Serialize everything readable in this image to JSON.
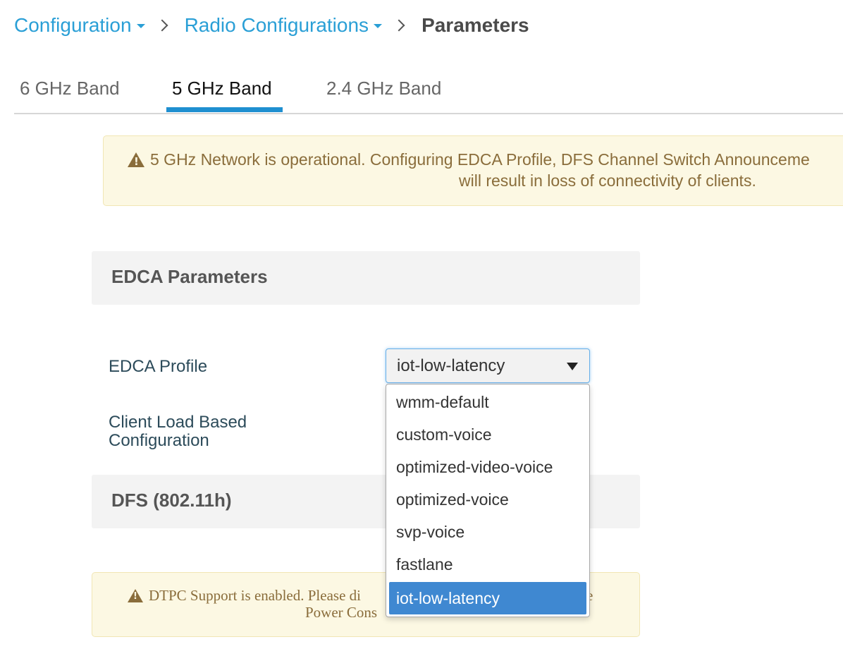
{
  "breadcrumb": {
    "items": [
      "Configuration",
      "Radio Configurations"
    ],
    "current": "Parameters"
  },
  "tabs": [
    {
      "label": "6 GHz Band",
      "active": false
    },
    {
      "label": "5 GHz Band",
      "active": true
    },
    {
      "label": "2.4 GHz Band",
      "active": false
    }
  ],
  "alert_top": {
    "line1": "5 GHz Network is operational. Configuring EDCA Profile, DFS Channel Switch Announceme",
    "line2": "will result in loss of connectivity of clients."
  },
  "sections": {
    "edca_title": "EDCA Parameters",
    "dfs_title": "DFS (802.11h)"
  },
  "form": {
    "edca_profile_label": "EDCA Profile",
    "client_load_label_1": "Client Load Based",
    "client_load_label_2": "Configuration",
    "edca_profile_value": "iot-low-latency"
  },
  "dropdown": {
    "options": [
      "wmm-default",
      "custom-voice",
      "optimized-video-voice",
      "optimized-voice",
      "svp-voice",
      "fastlane",
      "iot-low-latency"
    ],
    "selected": "iot-low-latency"
  },
  "alert_bottom": {
    "line1_visible": "DTPC Support is enabled. Please di",
    "line1_tail": "e",
    "line2_visible": "Power Cons"
  },
  "colors": {
    "link": "#2a9fd6",
    "tab_active_underline": "#1f8fd0",
    "alert_bg": "#fcf8e3",
    "alert_text": "#8a6d3b",
    "option_selected_bg": "#3f88d1"
  },
  "icons": [
    "chevron-right-icon",
    "caret-down-icon",
    "warning-icon",
    "dropdown-arrow-icon"
  ]
}
